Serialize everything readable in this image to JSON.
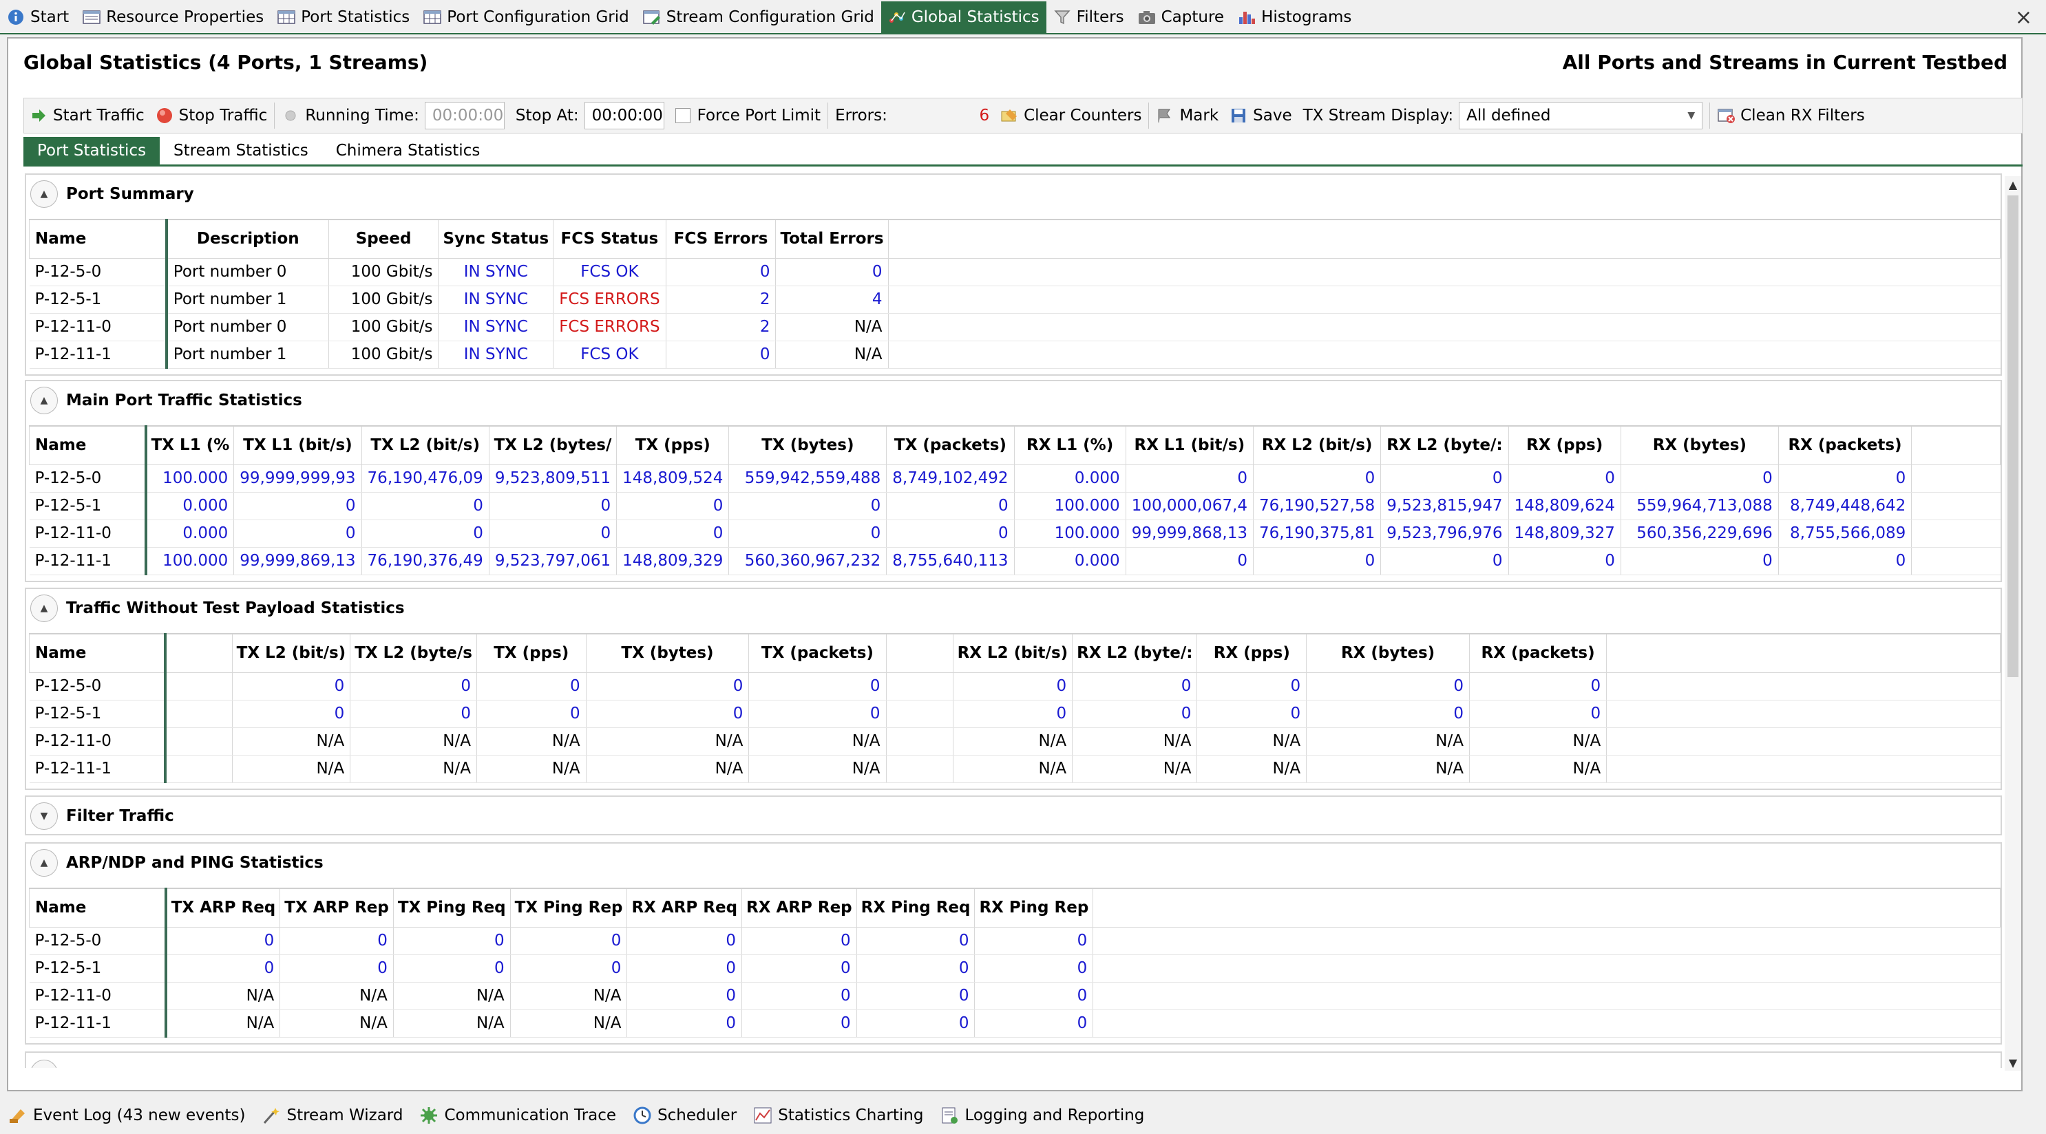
{
  "top_tabs": [
    {
      "label": "Start",
      "icon": "info-icon"
    },
    {
      "label": "Resource Properties",
      "icon": "properties-icon"
    },
    {
      "label": "Port Statistics",
      "icon": "grid-icon"
    },
    {
      "label": "Port Configuration Grid",
      "icon": "grid-icon"
    },
    {
      "label": "Stream Configuration Grid",
      "icon": "grid-edit-icon"
    },
    {
      "label": "Global Statistics",
      "icon": "stats-icon",
      "active": true
    },
    {
      "label": "Filters",
      "icon": "filter-icon"
    },
    {
      "label": "Capture",
      "icon": "camera-icon"
    },
    {
      "label": "Histograms",
      "icon": "histogram-icon"
    }
  ],
  "close_label": "×",
  "header": {
    "title": "Global Statistics (4 Ports, 1 Streams)",
    "scope": "All Ports and Streams in Current Testbed"
  },
  "toolbar": {
    "start_traffic": "Start Traffic",
    "stop_traffic": "Stop Traffic",
    "running_time_label": "Running Time:",
    "running_time_value": "00:00:00",
    "stop_at_label": "Stop At:",
    "stop_at_value": "00:00:00",
    "force_port_limit": "Force Port Limit",
    "errors_label": "Errors:",
    "errors_value": "6",
    "clear_counters": "Clear Counters",
    "mark": "Mark",
    "save": "Save",
    "tx_stream_display_label": "TX Stream Display:",
    "tx_stream_display_value": "All defined",
    "clean_rx_filters": "Clean RX Filters"
  },
  "sub_tabs": [
    "Port Statistics",
    "Stream Statistics",
    "Chimera Statistics"
  ],
  "port_summary": {
    "title": "Port Summary",
    "columns": [
      "Name",
      "Description",
      "Speed",
      "Sync Status",
      "FCS Status",
      "FCS Errors",
      "Total Errors"
    ],
    "rows": [
      [
        "P-12-5-0",
        "Port number 0",
        "100 Gbit/s",
        "IN SYNC",
        "FCS OK",
        "0",
        "0"
      ],
      [
        "P-12-5-1",
        "Port number 1",
        "100 Gbit/s",
        "IN SYNC",
        "FCS ERRORS",
        "2",
        "4"
      ],
      [
        "P-12-11-0",
        "Port number 0",
        "100 Gbit/s",
        "IN SYNC",
        "FCS ERRORS",
        "2",
        "N/A"
      ],
      [
        "P-12-11-1",
        "Port number 1",
        "100 Gbit/s",
        "IN SYNC",
        "FCS OK",
        "0",
        "N/A"
      ]
    ]
  },
  "main_traffic": {
    "title": "Main Port Traffic Statistics",
    "columns": [
      "Name",
      "TX L1 (%",
      "TX L1 (bit/s)",
      "TX L2 (bit/s)",
      "TX L2 (bytes/",
      "TX (pps)",
      "TX (bytes)",
      "TX (packets)",
      "RX L1 (%)",
      "RX L1 (bit/s)",
      "RX L2 (bit/s)",
      "RX L2 (byte/:",
      "RX (pps)",
      "RX (bytes)",
      "RX (packets)"
    ],
    "rows": [
      [
        "P-12-5-0",
        "100.000",
        "99,999,999,93",
        "76,190,476,09",
        "9,523,809,511",
        "148,809,524",
        "559,942,559,488",
        "8,749,102,492",
        "0.000",
        "0",
        "0",
        "0",
        "0",
        "0",
        "0"
      ],
      [
        "P-12-5-1",
        "0.000",
        "0",
        "0",
        "0",
        "0",
        "0",
        "0",
        "100.000",
        "100,000,067,4",
        "76,190,527,58",
        "9,523,815,947",
        "148,809,624",
        "559,964,713,088",
        "8,749,448,642"
      ],
      [
        "P-12-11-0",
        "0.000",
        "0",
        "0",
        "0",
        "0",
        "0",
        "0",
        "100.000",
        "99,999,868,13",
        "76,190,375,81",
        "9,523,796,976",
        "148,809,327",
        "560,356,229,696",
        "8,755,566,089"
      ],
      [
        "P-12-11-1",
        "100.000",
        "99,999,869,13",
        "76,190,376,49",
        "9,523,797,061",
        "148,809,329",
        "560,360,967,232",
        "8,755,640,113",
        "0.000",
        "0",
        "0",
        "0",
        "0",
        "0",
        "0"
      ]
    ]
  },
  "no_payload": {
    "title": "Traffic Without Test Payload Statistics",
    "columns": [
      "Name",
      "",
      "TX L2 (bit/s)",
      "TX L2 (byte/s",
      "TX (pps)",
      "TX (bytes)",
      "TX (packets)",
      "",
      "RX L2 (bit/s)",
      "RX L2 (byte/:",
      "RX (pps)",
      "RX (bytes)",
      "RX (packets)"
    ],
    "rows": [
      [
        "P-12-5-0",
        "",
        "0",
        "0",
        "0",
        "0",
        "0",
        "",
        "0",
        "0",
        "0",
        "0",
        "0"
      ],
      [
        "P-12-5-1",
        "",
        "0",
        "0",
        "0",
        "0",
        "0",
        "",
        "0",
        "0",
        "0",
        "0",
        "0"
      ],
      [
        "P-12-11-0",
        "",
        "N/A",
        "N/A",
        "N/A",
        "N/A",
        "N/A",
        "",
        "N/A",
        "N/A",
        "N/A",
        "N/A",
        "N/A"
      ],
      [
        "P-12-11-1",
        "",
        "N/A",
        "N/A",
        "N/A",
        "N/A",
        "N/A",
        "",
        "N/A",
        "N/A",
        "N/A",
        "N/A",
        "N/A"
      ]
    ]
  },
  "filter_traffic": {
    "title": "Filter Traffic"
  },
  "arp": {
    "title": "ARP/NDP and PING Statistics",
    "columns": [
      "Name",
      "TX ARP Req",
      "TX ARP Rep",
      "TX Ping Req",
      "TX Ping Rep",
      "RX ARP Req",
      "RX ARP Rep",
      "RX Ping Req",
      "RX Ping Rep"
    ],
    "rows": [
      [
        "P-12-5-0",
        "0",
        "0",
        "0",
        "0",
        "0",
        "0",
        "0",
        "0"
      ],
      [
        "P-12-5-1",
        "0",
        "0",
        "0",
        "0",
        "0",
        "0",
        "0",
        "0"
      ],
      [
        "P-12-11-0",
        "N/A",
        "N/A",
        "N/A",
        "N/A",
        "0",
        "0",
        "0",
        "0"
      ],
      [
        "P-12-11-1",
        "N/A",
        "N/A",
        "N/A",
        "N/A",
        "0",
        "0",
        "0",
        "0"
      ]
    ]
  },
  "bottom_bar": [
    {
      "label": "Event Log (43 new events)",
      "icon": "event-log-icon"
    },
    {
      "label": "Stream Wizard",
      "icon": "wizard-icon"
    },
    {
      "label": "Communication Trace",
      "icon": "trace-icon"
    },
    {
      "label": "Scheduler",
      "icon": "clock-icon"
    },
    {
      "label": "Statistics Charting",
      "icon": "chart-icon"
    },
    {
      "label": "Logging and Reporting",
      "icon": "report-icon"
    }
  ],
  "colors": {
    "accent": "#2d6e45",
    "value_blue": "#1a1ad1",
    "error_red": "#d31a1a"
  }
}
